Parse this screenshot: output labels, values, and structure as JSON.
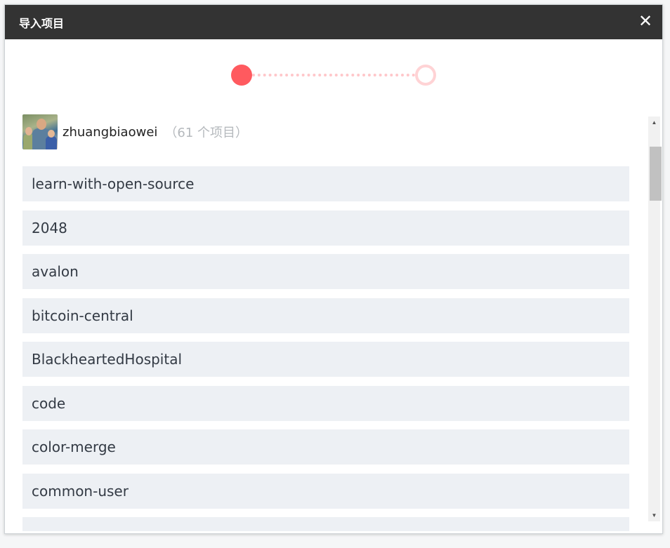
{
  "modal": {
    "title": "导入项目",
    "close_glyph": "✕"
  },
  "stepper": {
    "active_color": "#ff5a5f",
    "inactive_color": "#ffd3d5",
    "current_step": 1,
    "total_steps": 2
  },
  "owner": {
    "name": "zhuangbiaowei",
    "count_label": "（61 个项目）"
  },
  "repos": [
    "learn-with-open-source",
    "2048",
    "avalon",
    "bitcoin-central",
    "BlackheartedHospital",
    "code",
    "color-merge",
    "common-user"
  ],
  "scrollbar": {
    "up_glyph": "▲",
    "down_glyph": "▼"
  },
  "colors": {
    "header_bg": "#333333",
    "item_bg": "#edf0f4"
  }
}
